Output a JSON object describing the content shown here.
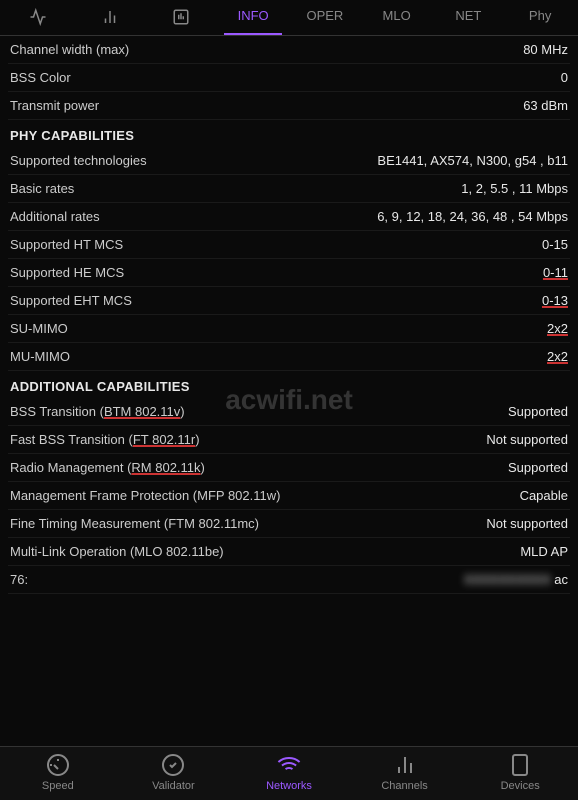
{
  "topTabs": [
    {
      "id": "signal",
      "label": "~",
      "icon": "signal",
      "active": false
    },
    {
      "id": "chart",
      "label": "chart",
      "active": false
    },
    {
      "id": "bar",
      "label": "bar",
      "active": false
    },
    {
      "id": "info",
      "label": "INFO",
      "active": true
    },
    {
      "id": "oper",
      "label": "OPER",
      "active": false
    },
    {
      "id": "mlo",
      "label": "MLO",
      "active": false
    },
    {
      "id": "net",
      "label": "NET",
      "active": false
    },
    {
      "id": "phy",
      "label": "Phy",
      "active": false
    }
  ],
  "infoRows": [
    {
      "label": "Channel width (max)",
      "value": "80 MHz"
    },
    {
      "label": "BSS Color",
      "value": "0"
    },
    {
      "label": "Transmit power",
      "value": "63 dBm"
    }
  ],
  "phyCapabilitiesHeader": "PHY CAPABILITIES",
  "phyRows": [
    {
      "label": "Supported technologies",
      "value": "BE1441, AX574, N300, g54 , b11",
      "labelUnderline": false,
      "valueUnderline": false
    },
    {
      "label": "Basic rates",
      "value": "1, 2, 5.5 , 11 Mbps",
      "labelUnderline": false,
      "valueUnderline": false
    },
    {
      "label": "Additional rates",
      "value": "6, 9, 12, 18, 24, 36, 48 , 54 Mbps",
      "labelUnderline": false,
      "valueUnderline": false
    },
    {
      "label": "Supported HT MCS",
      "value": "0-15",
      "labelUnderline": false,
      "valueUnderline": false
    },
    {
      "label": "Supported HE MCS",
      "value": "0-11",
      "labelUnderline": false,
      "valueUnderline": true
    },
    {
      "label": "Supported EHT MCS",
      "value": "0-13",
      "labelUnderline": false,
      "valueUnderline": true
    },
    {
      "label": "SU-MIMO",
      "value": "2x2",
      "labelUnderline": false,
      "valueUnderline": true
    },
    {
      "label": "MU-MIMO",
      "value": "2x2",
      "labelUnderline": false,
      "valueUnderline": true
    }
  ],
  "additionalCapabilitiesHeader": "ADDITIONAL CAPABILITIES",
  "additionalRows": [
    {
      "label": "BSS Transition (",
      "labelProto": "BTM 802.11v",
      "labelSuffix": ")",
      "value": "Supported",
      "protoUnderline": true
    },
    {
      "label": "Fast BSS Transition (",
      "labelProto": "FT 802.11r",
      "labelSuffix": ")",
      "value": "Not supported",
      "protoUnderline": true
    },
    {
      "label": "Radio Management (",
      "labelProto": "RM 802.11k",
      "labelSuffix": ")",
      "value": "Supported",
      "protoUnderline": true
    },
    {
      "label": "Management Frame Protection (MFP 802.11w)",
      "labelProto": "",
      "labelSuffix": "",
      "value": "Capable",
      "protoUnderline": false
    },
    {
      "label": "Fine Timing Measurement (FTM 802.11mc)",
      "labelProto": "",
      "labelSuffix": "",
      "value": "Not supported",
      "protoUnderline": false
    },
    {
      "label": "Multi-Link Operation (MLO 802.11be)",
      "labelProto": "",
      "labelSuffix": "",
      "value": "MLD AP",
      "protoUnderline": false
    }
  ],
  "lastRow": {
    "label": "76:",
    "value": "ac"
  },
  "watermark": "acwifi.net",
  "bottomNav": [
    {
      "id": "speed",
      "label": "Speed",
      "active": false,
      "iconType": "speed"
    },
    {
      "id": "validator",
      "label": "Validator",
      "active": false,
      "iconType": "validator"
    },
    {
      "id": "networks",
      "label": "Networks",
      "active": true,
      "iconType": "networks"
    },
    {
      "id": "channels",
      "label": "Channels",
      "active": false,
      "iconType": "channels"
    },
    {
      "id": "devices",
      "label": "Devices",
      "active": false,
      "iconType": "devices"
    }
  ]
}
